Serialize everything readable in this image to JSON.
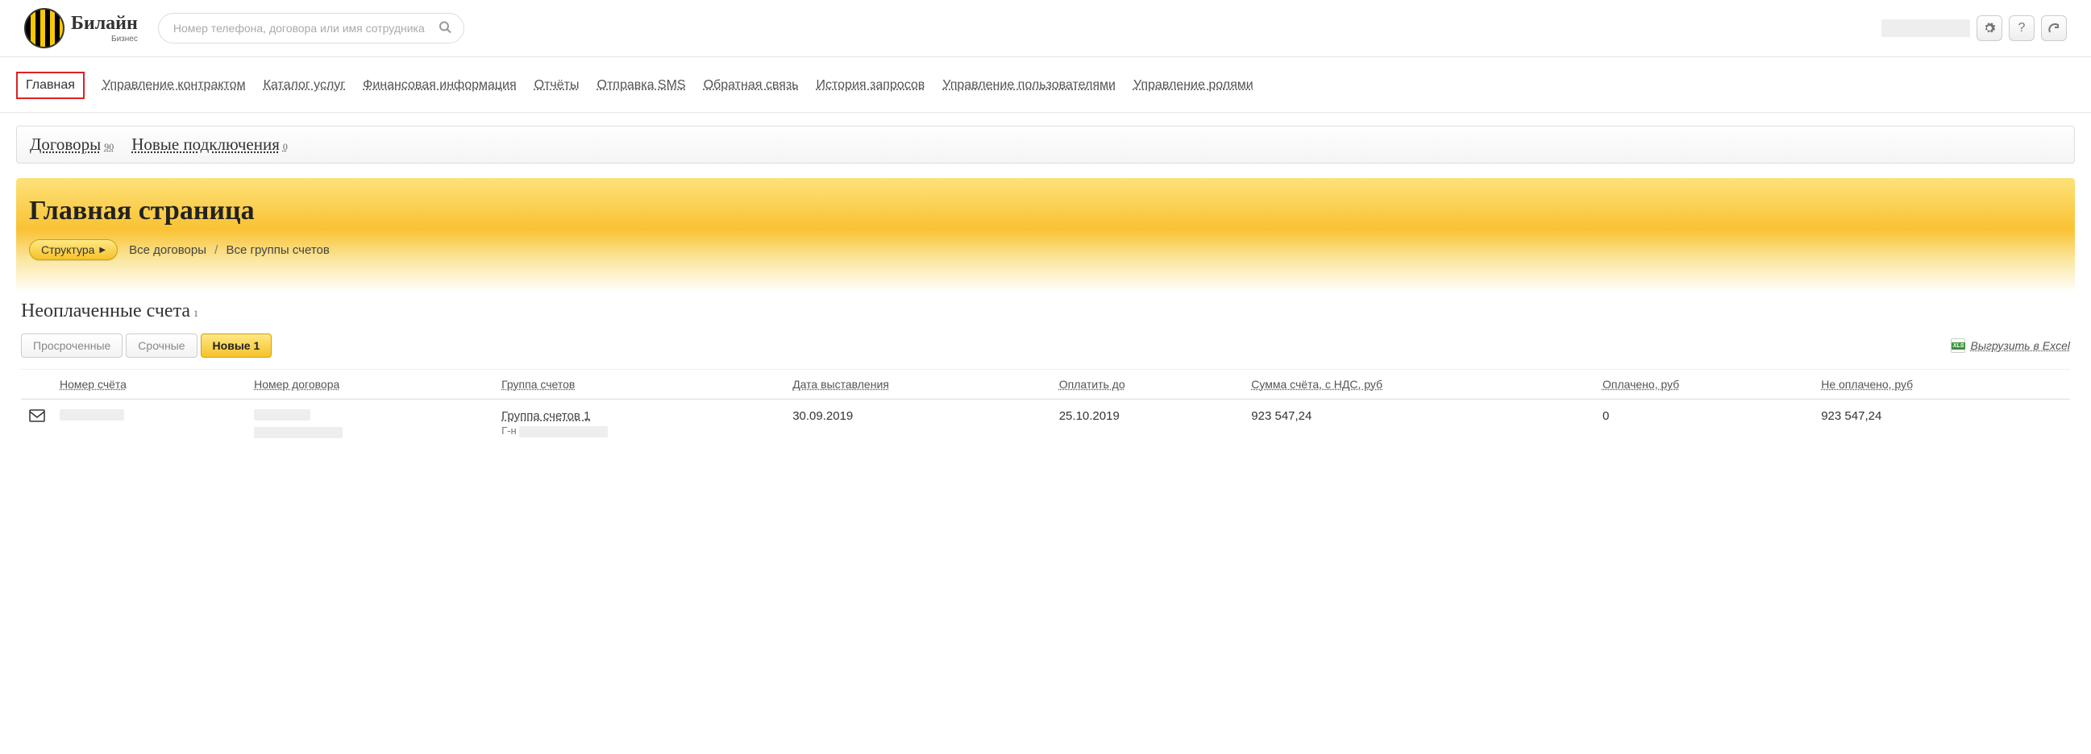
{
  "header": {
    "brand": "Билайн",
    "brand_sub": "Бизнес",
    "search_placeholder": "Номер телефона, договора или имя сотрудника",
    "tool_help": "?",
    "tool_settings_icon": "gear-icon",
    "tool_refresh_icon": "refresh-icon"
  },
  "nav": {
    "items": [
      "Главная",
      "Управление контрактом",
      "Каталог услуг",
      "Финансовая информация",
      "Отчёты",
      "Отправка SMS",
      "Обратная связь",
      "История запросов",
      "Управление пользователями",
      "Управление ролями"
    ]
  },
  "subtabs": {
    "contracts_label": "Договоры",
    "contracts_count": "90",
    "new_conn_label": "Новые подключения",
    "new_conn_count": "0"
  },
  "gold": {
    "title": "Главная страница",
    "structure_btn": "Структура",
    "crumb_all_contracts": "Все договоры",
    "crumb_all_groups": "Все группы счетов",
    "crumb_sep": "/"
  },
  "unpaid": {
    "heading": "Неоплаченные счета",
    "heading_count": "1",
    "tabs": {
      "overdue": "Просроченные",
      "urgent": "Срочные",
      "new": "Новые 1"
    },
    "export_label": "Выгрузить в Excel",
    "columns": {
      "invoice_no": "Номер счёта",
      "contract_no": "Номер договора",
      "group": "Группа счетов",
      "issue_date": "Дата выставления",
      "pay_until": "Оплатить до",
      "amount_vat": "Сумма счёта, с НДС, руб",
      "paid": "Оплачено, руб",
      "unpaid": "Не оплачено, руб"
    },
    "row": {
      "group_link": "Группа счетов 1",
      "group_sub_prefix": "Г-н",
      "issue_date": "30.09.2019",
      "pay_until": "25.10.2019",
      "amount_vat": "923 547,24",
      "paid": "0",
      "unpaid": "923 547,24"
    }
  }
}
